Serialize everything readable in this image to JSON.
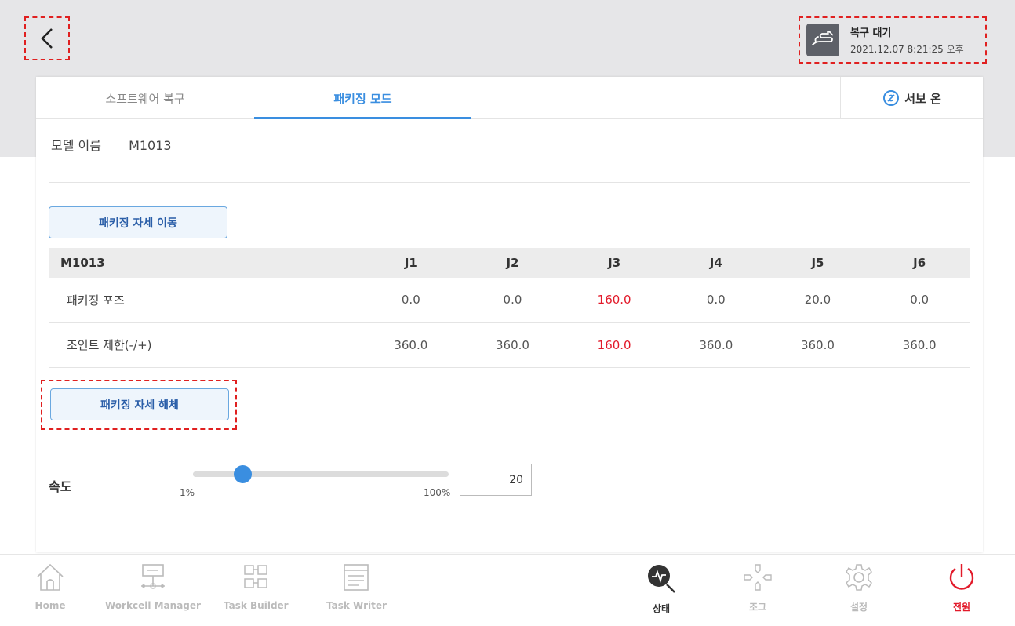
{
  "header": {
    "status_title": "복구 대기",
    "status_time": "2021.12.07 8:21:25 오후"
  },
  "tabs": {
    "software_recovery": "소프트웨어 복구",
    "packaging_mode": "패키징 모드",
    "servo_on": "서보 온"
  },
  "model": {
    "label": "모델 이름",
    "value": "M1013"
  },
  "buttons": {
    "move_to_packaging_pose": "패키징 자세 이동",
    "release_packaging_pose": "패키징 자세 해체"
  },
  "table": {
    "columns": [
      "M1013",
      "J1",
      "J2",
      "J3",
      "J4",
      "J5",
      "J6"
    ],
    "rows": [
      {
        "label": "패키징 포즈",
        "values": [
          "0.0",
          "0.0",
          "160.0",
          "0.0",
          "20.0",
          "0.0"
        ]
      },
      {
        "label": "조인트 제한(-/+)",
        "values": [
          "360.0",
          "360.0",
          "160.0",
          "360.0",
          "360.0",
          "360.0"
        ]
      }
    ],
    "highlight_color": "#e21a2a"
  },
  "speed": {
    "label": "속도",
    "min_label": "1%",
    "max_label": "100%",
    "value": "20",
    "percent": 20
  },
  "bottom_nav": {
    "home": "Home",
    "workcell_manager": "Workcell Manager",
    "task_builder": "Task Builder",
    "task_writer": "Task Writer",
    "status": "상태",
    "jog": "조그",
    "settings": "설정",
    "power": "전원"
  },
  "colors": {
    "accent": "#3a8ee0",
    "alert": "#e02020"
  }
}
